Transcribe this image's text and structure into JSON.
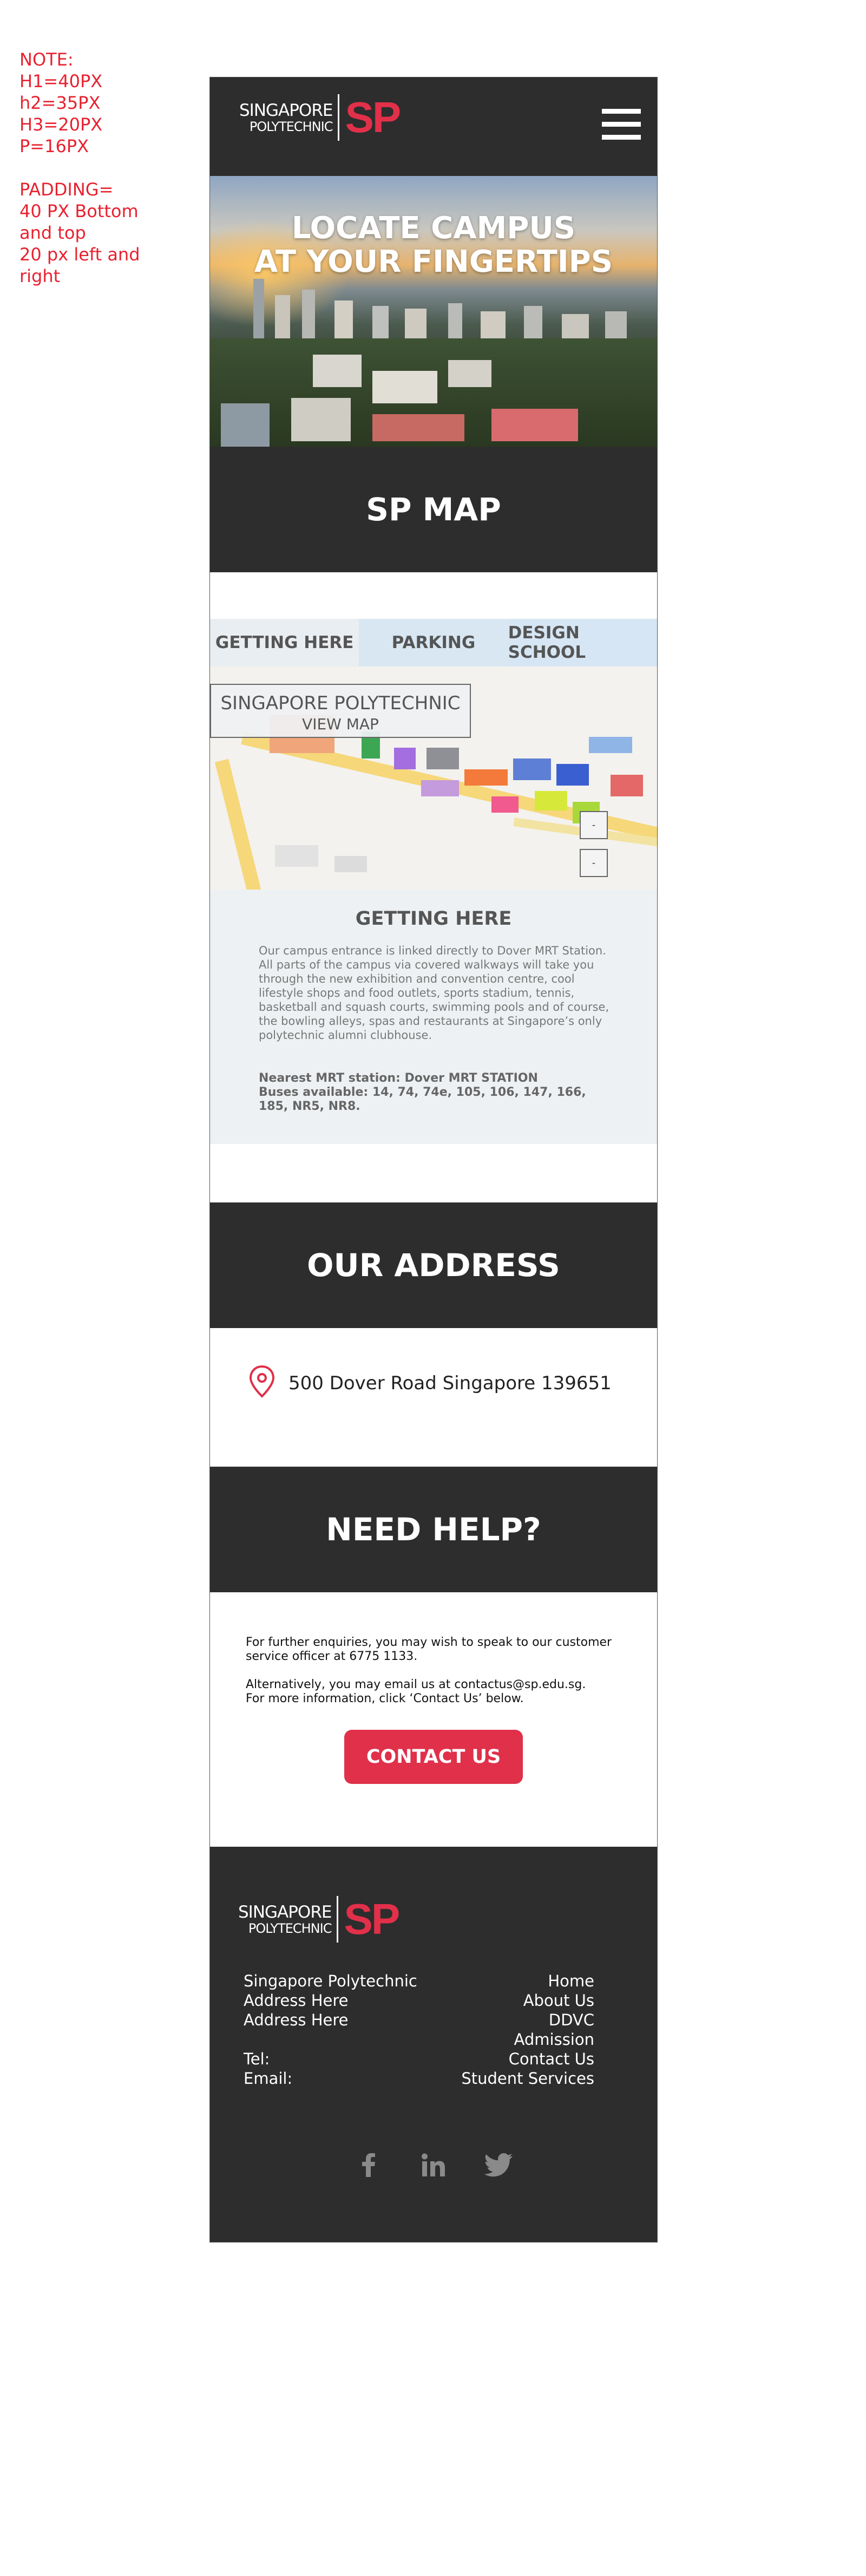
{
  "note": {
    "lines": [
      "NOTE:",
      "H1=40PX",
      "h2=35PX",
      "H3=20PX",
      "P=16PX"
    ],
    "padding_lines": [
      "PADDING=",
      "40 PX Bottom",
      "and top",
      "20 px left and",
      "right"
    ]
  },
  "header": {
    "logo": {
      "line1": "SINGAPORE",
      "line2": "POLYTECHNIC",
      "mark": "SP"
    },
    "menu_icon": "hamburger-icon"
  },
  "hero": {
    "title_line1": "LOCATE CAMPUS",
    "title_line2": "AT YOUR FINGERTIPS"
  },
  "map_section": {
    "title": "SP MAP"
  },
  "tabs": [
    {
      "label": "GETTING HERE"
    },
    {
      "label": "PARKING"
    },
    {
      "label": "DESIGN SCHOOL"
    }
  ],
  "map": {
    "label": "SINGAPORE POLYTECHNIC",
    "view_map": "VIEW MAP",
    "zoom_in": "-",
    "zoom_out": "-"
  },
  "getting_here": {
    "title": "GETTING HERE",
    "body": "Our campus entrance is linked  directly to Dover MRT Station. All parts of the campus via covered walkways will take you through the new exhibition and convention centre, cool lifestyle shops and food outlets, sports stadium, tennis, basketball and squash courts, swimming pools and of course, the bowling alleys, spas and restaurants at Singapore’s only polytechnic alumni clubhouse.",
    "mrt": "Nearest MRT station: Dover MRT STATION",
    "buses": "Buses available: 14, 74, 74e, 105, 106, 147, 166, 185, NR5, NR8."
  },
  "address_section": {
    "title": "OUR ADDRESS",
    "address": "500 Dover Road Singapore 139651"
  },
  "help_section": {
    "title": "NEED HELP?",
    "p1": "For further enquiries, you may wish to speak to our customer service officer at 6775 1133.",
    "p2a": "Alternatively, you may email us at contactus@sp.edu.sg.",
    "p2b": "For more information, click ‘Contact Us’ below.",
    "button": "CONTACT US"
  },
  "footer": {
    "logo": {
      "line1": "SINGAPORE",
      "line2": "POLYTECHNIC",
      "mark": "SP"
    },
    "left": [
      "Singapore Polytechnic",
      "Address Here",
      "Address Here",
      "",
      "Tel:",
      "Email:"
    ],
    "links": [
      "Home",
      "About Us",
      "DDVC",
      "Admission",
      "Contact Us",
      "Student Services"
    ],
    "social": [
      "facebook-icon",
      "linkedin-icon",
      "twitter-icon"
    ]
  },
  "colors": {
    "dark": "#2d2d2d",
    "accent": "#e0304a",
    "note": "#e8212f"
  }
}
